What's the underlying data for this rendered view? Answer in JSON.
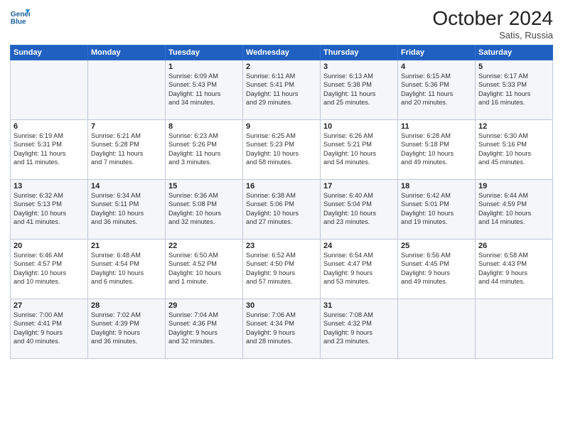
{
  "header": {
    "logo_line1": "General",
    "logo_line2": "Blue",
    "month": "October 2024",
    "location": "Satis, Russia"
  },
  "weekdays": [
    "Sunday",
    "Monday",
    "Tuesday",
    "Wednesday",
    "Thursday",
    "Friday",
    "Saturday"
  ],
  "weeks": [
    [
      {
        "day": "",
        "info": ""
      },
      {
        "day": "",
        "info": ""
      },
      {
        "day": "1",
        "info": "Sunrise: 6:09 AM\nSunset: 5:43 PM\nDaylight: 11 hours\nand 34 minutes."
      },
      {
        "day": "2",
        "info": "Sunrise: 6:11 AM\nSunset: 5:41 PM\nDaylight: 11 hours\nand 29 minutes."
      },
      {
        "day": "3",
        "info": "Sunrise: 6:13 AM\nSunset: 5:38 PM\nDaylight: 11 hours\nand 25 minutes."
      },
      {
        "day": "4",
        "info": "Sunrise: 6:15 AM\nSunset: 5:36 PM\nDaylight: 11 hours\nand 20 minutes."
      },
      {
        "day": "5",
        "info": "Sunrise: 6:17 AM\nSunset: 5:33 PM\nDaylight: 11 hours\nand 16 minutes."
      }
    ],
    [
      {
        "day": "6",
        "info": "Sunrise: 6:19 AM\nSunset: 5:31 PM\nDaylight: 11 hours\nand 11 minutes."
      },
      {
        "day": "7",
        "info": "Sunrise: 6:21 AM\nSunset: 5:28 PM\nDaylight: 11 hours\nand 7 minutes."
      },
      {
        "day": "8",
        "info": "Sunrise: 6:23 AM\nSunset: 5:26 PM\nDaylight: 11 hours\nand 3 minutes."
      },
      {
        "day": "9",
        "info": "Sunrise: 6:25 AM\nSunset: 5:23 PM\nDaylight: 10 hours\nand 58 minutes."
      },
      {
        "day": "10",
        "info": "Sunrise: 6:26 AM\nSunset: 5:21 PM\nDaylight: 10 hours\nand 54 minutes."
      },
      {
        "day": "11",
        "info": "Sunrise: 6:28 AM\nSunset: 5:18 PM\nDaylight: 10 hours\nand 49 minutes."
      },
      {
        "day": "12",
        "info": "Sunrise: 6:30 AM\nSunset: 5:16 PM\nDaylight: 10 hours\nand 45 minutes."
      }
    ],
    [
      {
        "day": "13",
        "info": "Sunrise: 6:32 AM\nSunset: 5:13 PM\nDaylight: 10 hours\nand 41 minutes."
      },
      {
        "day": "14",
        "info": "Sunrise: 6:34 AM\nSunset: 5:11 PM\nDaylight: 10 hours\nand 36 minutes."
      },
      {
        "day": "15",
        "info": "Sunrise: 6:36 AM\nSunset: 5:08 PM\nDaylight: 10 hours\nand 32 minutes."
      },
      {
        "day": "16",
        "info": "Sunrise: 6:38 AM\nSunset: 5:06 PM\nDaylight: 10 hours\nand 27 minutes."
      },
      {
        "day": "17",
        "info": "Sunrise: 6:40 AM\nSunset: 5:04 PM\nDaylight: 10 hours\nand 23 minutes."
      },
      {
        "day": "18",
        "info": "Sunrise: 6:42 AM\nSunset: 5:01 PM\nDaylight: 10 hours\nand 19 minutes."
      },
      {
        "day": "19",
        "info": "Sunrise: 6:44 AM\nSunset: 4:59 PM\nDaylight: 10 hours\nand 14 minutes."
      }
    ],
    [
      {
        "day": "20",
        "info": "Sunrise: 6:46 AM\nSunset: 4:57 PM\nDaylight: 10 hours\nand 10 minutes."
      },
      {
        "day": "21",
        "info": "Sunrise: 6:48 AM\nSunset: 4:54 PM\nDaylight: 10 hours\nand 6 minutes."
      },
      {
        "day": "22",
        "info": "Sunrise: 6:50 AM\nSunset: 4:52 PM\nDaylight: 10 hours\nand 1 minute."
      },
      {
        "day": "23",
        "info": "Sunrise: 6:52 AM\nSunset: 4:50 PM\nDaylight: 9 hours\nand 57 minutes."
      },
      {
        "day": "24",
        "info": "Sunrise: 6:54 AM\nSunset: 4:47 PM\nDaylight: 9 hours\nand 53 minutes."
      },
      {
        "day": "25",
        "info": "Sunrise: 6:56 AM\nSunset: 4:45 PM\nDaylight: 9 hours\nand 49 minutes."
      },
      {
        "day": "26",
        "info": "Sunrise: 6:58 AM\nSunset: 4:43 PM\nDaylight: 9 hours\nand 44 minutes."
      }
    ],
    [
      {
        "day": "27",
        "info": "Sunrise: 7:00 AM\nSunset: 4:41 PM\nDaylight: 9 hours\nand 40 minutes."
      },
      {
        "day": "28",
        "info": "Sunrise: 7:02 AM\nSunset: 4:39 PM\nDaylight: 9 hours\nand 36 minutes."
      },
      {
        "day": "29",
        "info": "Sunrise: 7:04 AM\nSunset: 4:36 PM\nDaylight: 9 hours\nand 32 minutes."
      },
      {
        "day": "30",
        "info": "Sunrise: 7:06 AM\nSunset: 4:34 PM\nDaylight: 9 hours\nand 28 minutes."
      },
      {
        "day": "31",
        "info": "Sunrise: 7:08 AM\nSunset: 4:32 PM\nDaylight: 9 hours\nand 23 minutes."
      },
      {
        "day": "",
        "info": ""
      },
      {
        "day": "",
        "info": ""
      }
    ]
  ]
}
